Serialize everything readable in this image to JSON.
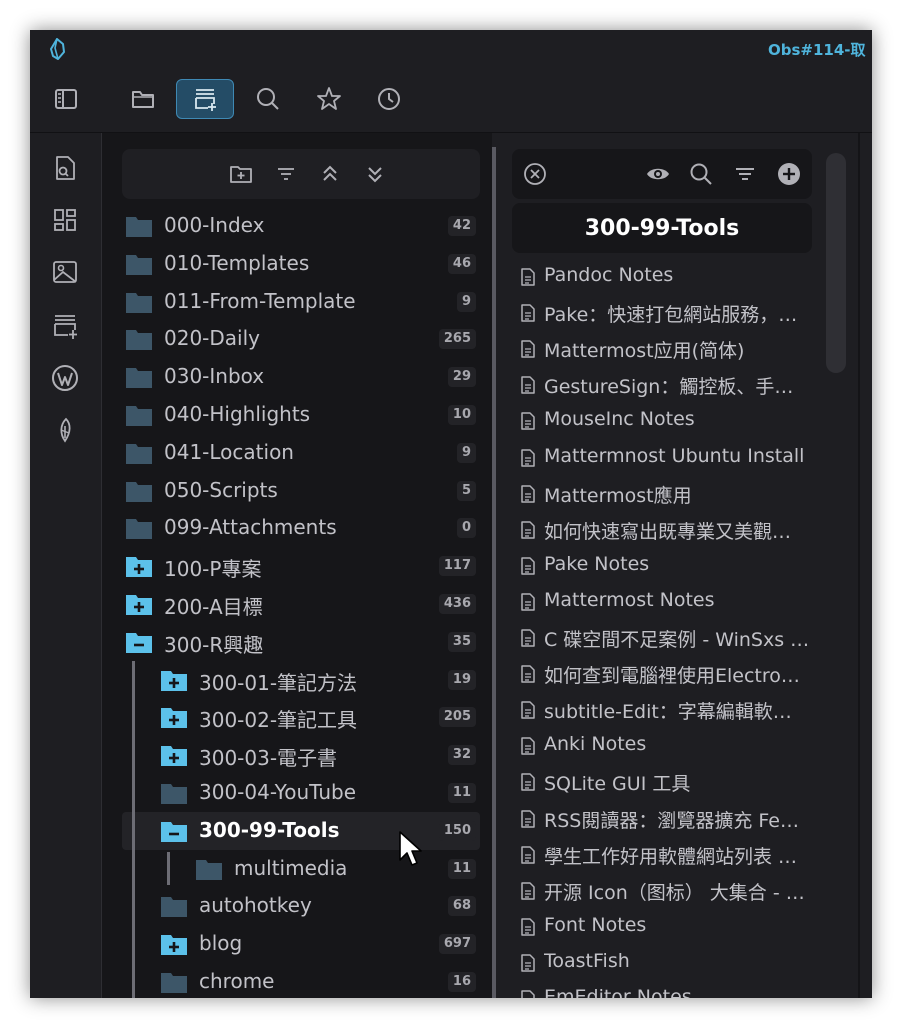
{
  "window": {
    "title": "Obs#114-取"
  },
  "tabbar": {
    "tabs": [
      {
        "name": "files-tab",
        "icon": "folder-icon",
        "active": false
      },
      {
        "name": "folder-notes-tab",
        "icon": "folder-card-plus-icon",
        "active": true
      },
      {
        "name": "search-tab",
        "icon": "search-icon",
        "active": false
      },
      {
        "name": "bookmarks-tab",
        "icon": "star-icon",
        "active": false
      },
      {
        "name": "recent-tab",
        "icon": "clock-icon",
        "active": false
      }
    ]
  },
  "ribbon": {
    "items": [
      "toggle-sidebar-icon",
      "file-search-icon",
      "layout-grid-icon",
      "image-icon",
      "card-plus-icon",
      "wordpress-icon",
      "quill-icon"
    ]
  },
  "folder_tree": {
    "items": [
      {
        "label": "000-Index",
        "count": "42",
        "state": "closed",
        "depth": 0
      },
      {
        "label": "010-Templates",
        "count": "46",
        "state": "closed",
        "depth": 0
      },
      {
        "label": "011-From-Template",
        "count": "9",
        "state": "closed",
        "depth": 0
      },
      {
        "label": "020-Daily",
        "count": "265",
        "state": "closed",
        "depth": 0
      },
      {
        "label": "030-Inbox",
        "count": "29",
        "state": "closed",
        "depth": 0
      },
      {
        "label": "040-Highlights",
        "count": "10",
        "state": "closed",
        "depth": 0
      },
      {
        "label": "041-Location",
        "count": "9",
        "state": "closed",
        "depth": 0
      },
      {
        "label": "050-Scripts",
        "count": "5",
        "state": "closed",
        "depth": 0
      },
      {
        "label": "099-Attachments",
        "count": "0",
        "state": "closed",
        "depth": 0
      },
      {
        "label": "100-P專案",
        "count": "117",
        "state": "expandable",
        "depth": 0
      },
      {
        "label": "200-A目標",
        "count": "436",
        "state": "expandable",
        "depth": 0
      },
      {
        "label": "300-R興趣",
        "count": "35",
        "state": "expanded",
        "depth": 0
      },
      {
        "label": "300-01-筆記方法",
        "count": "19",
        "state": "expandable",
        "depth": 1
      },
      {
        "label": "300-02-筆記工具",
        "count": "205",
        "state": "expandable",
        "depth": 1
      },
      {
        "label": "300-03-電子書",
        "count": "32",
        "state": "expandable",
        "depth": 1
      },
      {
        "label": "300-04-YouTube",
        "count": "11",
        "state": "closed",
        "depth": 1
      },
      {
        "label": "300-99-Tools",
        "count": "150",
        "state": "expanded",
        "depth": 1,
        "selected": true
      },
      {
        "label": "multimedia",
        "count": "11",
        "state": "closed",
        "depth": 2
      },
      {
        "label": "autohotkey",
        "count": "68",
        "state": "closed",
        "depth": 1
      },
      {
        "label": "blog",
        "count": "697",
        "state": "expandable",
        "depth": 1
      },
      {
        "label": "chrome",
        "count": "16",
        "state": "closed",
        "depth": 1
      }
    ]
  },
  "file_pane": {
    "header": "300-99-Tools",
    "files": [
      "Pandoc Notes",
      "Pake：快速打包網站服務，…",
      "Mattermost应用(简体)",
      "GestureSign：觸控板、手…",
      "MouseInc Notes",
      "Mattermnost Ubuntu Install",
      "Mattermost應用",
      "如何快速寫出既專業又美觀…",
      "Pake Notes",
      "Mattermost Notes",
      "C 碟空間不足案例 - WinSxs …",
      "如何查到電腦裡使用Electro…",
      "subtitle-Edit：字幕編輯軟…",
      "Anki Notes",
      "SQLite GUI 工具",
      "RSS閱讀器：瀏覽器擴充 Fe…",
      "學生工作好用軟體網站列表 …",
      "开源 Icon（图标） 大集合 - …",
      "Font Notes",
      "ToastFish",
      "EmEditor Notes"
    ]
  },
  "colors": {
    "accent": "#4fb4dc",
    "folder_closed": "#3d5668",
    "folder_open": "#5cc1ea",
    "bg": "#1e1e22",
    "pane": "#161619"
  }
}
